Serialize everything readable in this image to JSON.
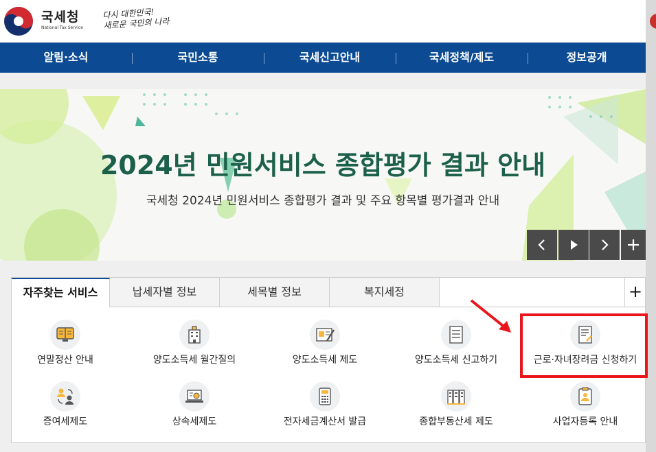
{
  "header": {
    "logo_name": "국세청",
    "logo_sub": "National Tax Service",
    "slogan": "다시 대한민국!\n새로운 국민의 나라"
  },
  "nav": {
    "items": [
      "알림·소식",
      "국민소통",
      "국세신고안내",
      "국세정책/제도",
      "정보공개"
    ]
  },
  "banner": {
    "title": "2024년 민원서비스 종합평가 결과 안내",
    "subtitle": "국세청 2024년 민원서비스 종합평가 결과 및 주요 항목별 평가결과 안내",
    "controls": [
      "prev-icon",
      "play-icon",
      "next-icon",
      "plus-icon"
    ]
  },
  "tabs": {
    "items": [
      "자주찾는 서비스",
      "납세자별 정보",
      "세목별 정보",
      "복지세정"
    ],
    "active": "자주찾는 서비스",
    "more": "+"
  },
  "services": [
    {
      "label": "연말정산 안내",
      "icon": "book-monitor-icon"
    },
    {
      "label": "양도소득세 월간질의",
      "icon": "building-icon"
    },
    {
      "label": "양도소득세 제도",
      "icon": "document-pen-icon"
    },
    {
      "label": "양도소득세 신고하기",
      "icon": "form-list-icon"
    },
    {
      "label": "근로·자녀장려금 신청하기",
      "icon": "application-form-icon"
    },
    {
      "label": "증여세제도",
      "icon": "people-exchange-icon"
    },
    {
      "label": "상속세제도",
      "icon": "laptop-search-icon"
    },
    {
      "label": "전자세금계산서 발급",
      "icon": "calculator-icon"
    },
    {
      "label": "종합부동산세 제도",
      "icon": "buildings-row-icon"
    },
    {
      "label": "사업자등록 안내",
      "icon": "clipboard-person-icon"
    }
  ],
  "colors": {
    "nav_bg": "#0c4b93",
    "banner_title": "#1c5f4a",
    "highlight": "#e8151b"
  }
}
